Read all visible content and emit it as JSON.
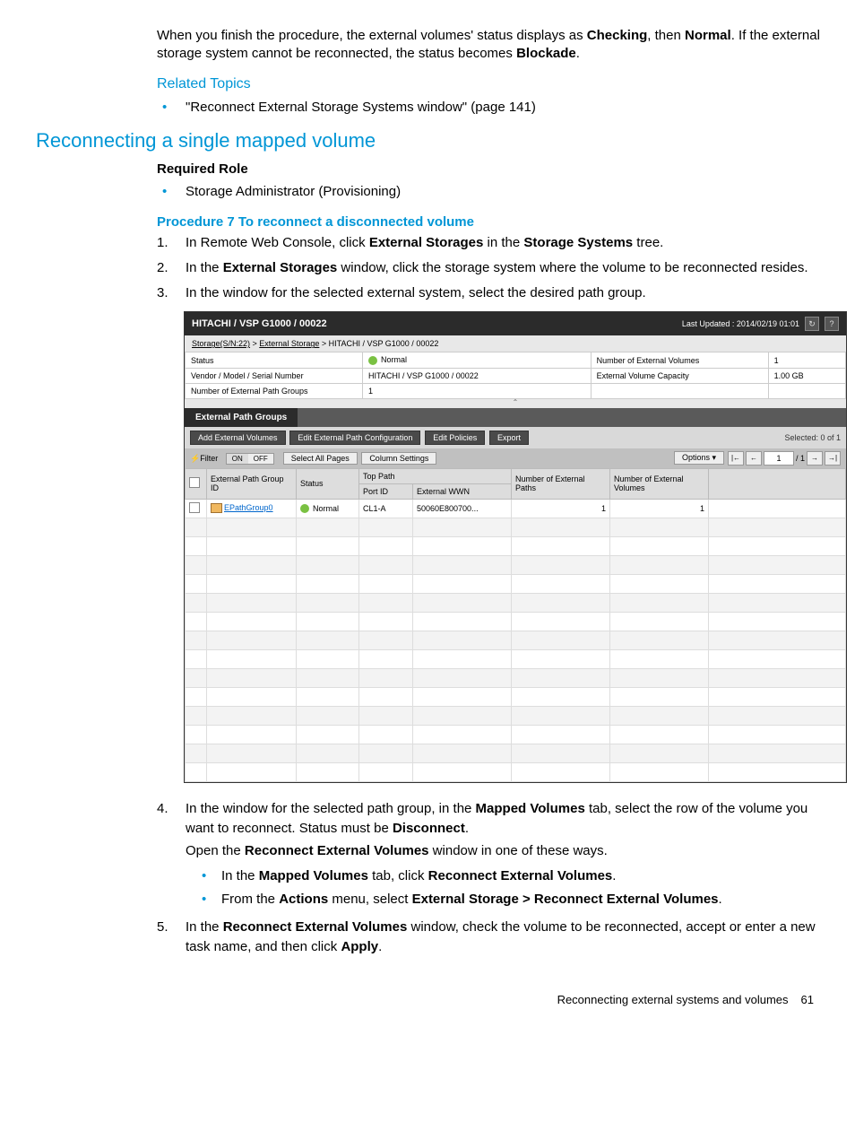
{
  "intro": {
    "p1a": "When you finish the procedure, the external volumes' status displays as ",
    "b1": "Checking",
    "p1b": ", then ",
    "b2": "Normal",
    "p1c": ". If the external storage system cannot be reconnected, the status becomes ",
    "b3": "Blockade",
    "p1d": "."
  },
  "related": {
    "heading": "Related Topics",
    "item1": "\"Reconnect External Storage Systems window\" (page 141)"
  },
  "h2": "Reconnecting a single mapped volume",
  "required_role": {
    "heading": "Required Role",
    "item1": "Storage Administrator (Provisioning)"
  },
  "proc_head": "Procedure 7 To reconnect a disconnected volume",
  "steps": {
    "s1a": "In Remote Web Console, click ",
    "s1b": "External Storages",
    "s1c": " in the ",
    "s1d": "Storage Systems",
    "s1e": " tree.",
    "s2a": "In the ",
    "s2b": "External Storages",
    "s2c": " window, click the storage system where the volume to be reconnected resides.",
    "s3": "In the window for the selected external system, select the desired path group.",
    "s4a": "In the window for the selected path group, in the ",
    "s4b": "Mapped Volumes",
    "s4c": " tab, select the row of the volume you want to reconnect. Status must be ",
    "s4d": "Disconnect",
    "s4e": ".",
    "s4pA": "Open the ",
    "s4pB": "Reconnect External Volumes",
    "s4pC": " window in one of these ways.",
    "s4i1a": "In the ",
    "s4i1b": "Mapped Volumes",
    "s4i1c": " tab, click ",
    "s4i1d": "Reconnect External Volumes",
    "s4i1e": ".",
    "s4i2a": "From the ",
    "s4i2b": "Actions",
    "s4i2c": " menu, select  ",
    "s4i2d": "External Storage > Reconnect External Volumes",
    "s4i2e": ".",
    "s5a": "In the ",
    "s5b": "Reconnect External Volumes",
    "s5c": " window, check the volume to be reconnected, accept or enter a new task name, and then click ",
    "s5d": "Apply",
    "s5e": "."
  },
  "ss": {
    "title": "HITACHI / VSP G1000 / 00022",
    "updated": "Last Updated : 2014/02/19 01:01",
    "refresh": "↻",
    "help": "?",
    "bc1": "Storage(S/N:22)",
    "bcs": " > ",
    "bc2": "External Storage",
    "bc3": "HITACHI / VSP G1000 / 00022",
    "sum": {
      "r1l": "Status",
      "r1v": "Normal",
      "r1l2": "Number of External Volumes",
      "r1v2": "1",
      "r2l": "Vendor / Model / Serial Number",
      "r2v": "HITACHI / VSP G1000 / 00022",
      "r2l2": "External Volume Capacity",
      "r2v2": "1.00 GB",
      "r3l": "Number of External Path Groups",
      "r3v": "1"
    },
    "tab": "External Path Groups",
    "btn_add": "Add External Volumes",
    "btn_edit": "Edit External Path Configuration",
    "btn_pol": "Edit Policies",
    "btn_exp": "Export",
    "selected": "Selected:  0   of  1",
    "filter_label": "⚡Filter",
    "on": "ON",
    "off": "OFF",
    "sel_all": "Select All Pages",
    "col_set": "Column Settings",
    "options": "Options ▾",
    "pg_first": "|←",
    "pg_prev": "←",
    "pg_cur": "1",
    "pg_sep": "/ 1",
    "pg_next": "→",
    "pg_last": "→|",
    "headers": {
      "chk": "",
      "id": "External Path Group ID",
      "status": "Status",
      "top": "Top Path",
      "port": "Port ID",
      "wwn": "External WWN",
      "paths": "Number of External Paths",
      "vols": "Number of External Volumes"
    },
    "row": {
      "id": "EPathGroup0",
      "status": "Normal",
      "port": "CL1-A",
      "wwn": "50060E800700...",
      "paths": "1",
      "vols": "1"
    }
  },
  "footer": {
    "text": "Reconnecting external systems and volumes",
    "page": "61"
  }
}
